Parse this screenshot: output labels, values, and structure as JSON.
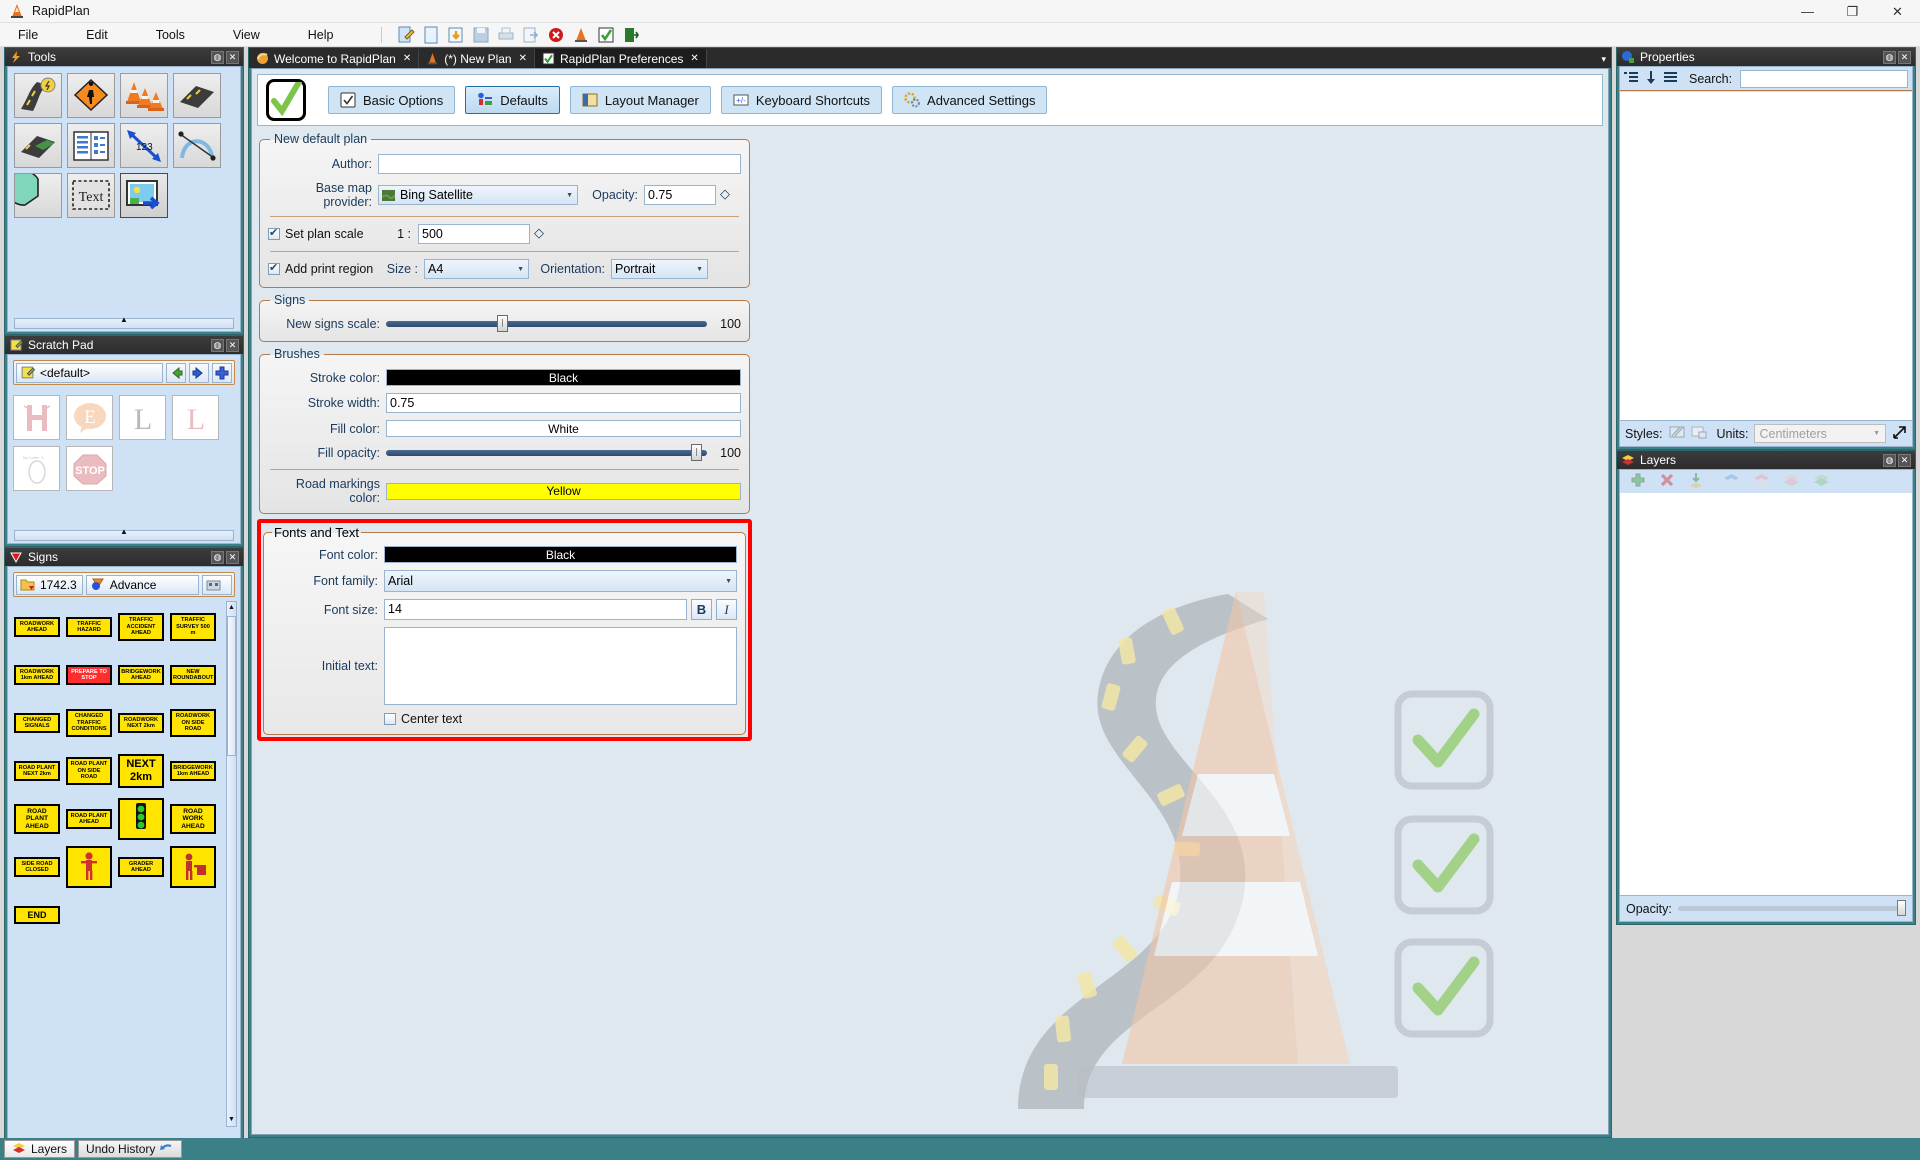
{
  "window": {
    "title": "RapidPlan",
    "app_icon": "rapidplan-cone-icon",
    "minimize": "—",
    "maximize": "❐",
    "close": "✕"
  },
  "menu": {
    "items": [
      {
        "label": "File",
        "name": "menu-file"
      },
      {
        "label": "Edit",
        "name": "menu-edit"
      },
      {
        "label": "Tools",
        "name": "menu-tools"
      },
      {
        "label": "View",
        "name": "menu-view"
      },
      {
        "label": "Help",
        "name": "menu-help"
      }
    ],
    "toolbar_icons": [
      "edit-plan-icon",
      "new-plan-icon",
      "open-plan-icon",
      "save-icon",
      "print-icon",
      "export-icon",
      "delete-icon",
      "cone-tool-icon",
      "preferences-check-icon",
      "exit-icon"
    ]
  },
  "tools_panel": {
    "title": "Tools",
    "icon": "lightning-icon",
    "pin": "◍",
    "close": "✕",
    "tools": [
      {
        "name": "road-tool",
        "label": "Road"
      },
      {
        "name": "sign-tool",
        "label": "Sign"
      },
      {
        "name": "cones-tool",
        "label": "Cones"
      },
      {
        "name": "road-segment-tool",
        "label": "Road segment"
      },
      {
        "name": "road-mesh-tool",
        "label": "Road mesh"
      },
      {
        "name": "legend-tool",
        "label": "Legend"
      },
      {
        "name": "dimension-tool",
        "label": "Dimension 123"
      },
      {
        "name": "curve-tool",
        "label": "Curve"
      },
      {
        "name": "arc-tool",
        "label": "Arc"
      },
      {
        "name": "text-tool",
        "label": "Text"
      },
      {
        "name": "image-tool",
        "label": "Image"
      }
    ]
  },
  "scratch_pad": {
    "title": "Scratch Pad",
    "icon": "notepad-icon",
    "pin": "◍",
    "close": "✕",
    "selected_set": "<default>",
    "set_icon": "notepad-icon",
    "prev_label": "◀",
    "next_label": "▶",
    "add_label": "✛",
    "items": [
      {
        "name": "scratch-item-h",
        "glyph": "H"
      },
      {
        "name": "scratch-item-e",
        "glyph": "E"
      },
      {
        "name": "scratch-item-l",
        "glyph": "L"
      },
      {
        "name": "scratch-item-l2",
        "glyph": "L"
      },
      {
        "name": "scratch-item-o",
        "glyph": "O"
      },
      {
        "name": "scratch-item-stop",
        "glyph": "STOP"
      }
    ]
  },
  "signs_panel": {
    "title": "Signs",
    "icon": "triangle-sign-icon",
    "pin": "◍",
    "close": "✕",
    "library_button": "1742.3",
    "library_icon": "folder-icon",
    "category_button": "Advance",
    "category_icon": "advance-icon",
    "more_icon": "grid-icon",
    "signs": [
      "ROADWORK AHEAD",
      "TRAFFIC HAZARD",
      "TRAFFIC ACCIDENT AHEAD",
      "TRAFFIC SURVEY 500 m",
      "ROADWORK 1km AHEAD",
      "PREPARE TO STOP",
      "BRIDGEWORK AHEAD",
      "NEW ROUNDABOUT",
      "CHANGED SIGNALS",
      "CHANGED TRAFFIC CONDITIONS",
      "ROADWORK NEXT 2km",
      "ROADWORK ON SIDE ROAD",
      "ROAD PLANT NEXT 2km",
      "ROAD PLANT ON SIDE ROAD",
      "NEXT 2km",
      "BRIDGEWORK 1km AHEAD",
      "ROAD PLANT AHEAD",
      "ROAD PLANT AHEAD",
      "TRAFFIC LIGHTS",
      "ROAD WORK AHEAD",
      "SIDE ROAD CLOSED",
      "WORKER SYMBOL",
      "GRADER AHEAD",
      "WORKER SYMBOL 2",
      "END"
    ]
  },
  "tabs": [
    {
      "label": "Welcome to RapidPlan",
      "icon": "welcome-icon",
      "active": false,
      "close": "✕"
    },
    {
      "label": "(*) New Plan",
      "icon": "cone-icon",
      "active": false,
      "close": "✕"
    },
    {
      "label": "RapidPlan Preferences",
      "icon": "check-icon",
      "active": true,
      "close": "✕"
    }
  ],
  "preferences": {
    "header_icon": "big-check-icon",
    "nav_tabs": [
      {
        "label": "Basic Options",
        "icon": "check-box-icon",
        "active": false
      },
      {
        "label": "Defaults",
        "icon": "defaults-icon",
        "active": true
      },
      {
        "label": "Layout Manager",
        "icon": "layout-icon",
        "active": false
      },
      {
        "label": "Keyboard Shortcuts",
        "icon": "keyboard-icon",
        "active": false
      },
      {
        "label": "Advanced Settings",
        "icon": "gears-icon",
        "active": false
      }
    ],
    "new_default_plan": {
      "legend": "New default plan",
      "author_label": "Author:",
      "author_value": "",
      "base_map_label": "Base map provider:",
      "base_map_value": "Bing Satellite",
      "base_map_icon": "satellite-thumb-icon",
      "opacity_label": "Opacity:",
      "opacity_value": "0.75",
      "set_plan_scale_label": "Set plan scale",
      "set_plan_scale_checked": true,
      "scale_prefix": "1 :",
      "scale_value": "500",
      "add_print_region_label": "Add print region",
      "add_print_region_checked": true,
      "size_label": "Size :",
      "size_value": "A4",
      "orientation_label": "Orientation:",
      "orientation_value": "Portrait"
    },
    "signs": {
      "legend": "Signs",
      "new_signs_scale_label": "New signs scale:",
      "new_signs_scale_value": "100",
      "slider_percent": 36
    },
    "brushes": {
      "legend": "Brushes",
      "stroke_color_label": "Stroke color:",
      "stroke_color_value": "Black",
      "stroke_color_hex": "#000000",
      "stroke_color_text_hex": "#ffffff",
      "stroke_width_label": "Stroke width:",
      "stroke_width_value": "0.75",
      "fill_color_label": "Fill color:",
      "fill_color_value": "White",
      "fill_color_hex": "#ffffff",
      "fill_color_text_hex": "#000000",
      "fill_opacity_label": "Fill opacity:",
      "fill_opacity_value": "100",
      "fill_opacity_percent": 97,
      "road_markings_label": "Road markings color:",
      "road_markings_value": "Yellow",
      "road_markings_hex": "#ffff00",
      "road_markings_text_hex": "#000000"
    },
    "fonts_and_text": {
      "legend": "Fonts and Text",
      "highlight_hex": "#ff0000",
      "font_color_label": "Font color:",
      "font_color_value": "Black",
      "font_color_hex": "#000000",
      "font_color_text_hex": "#ffffff",
      "font_family_label": "Font family:",
      "font_family_value": "Arial",
      "font_size_label": "Font size:",
      "font_size_value": "14",
      "bold_label": "B",
      "italic_label": "I",
      "initial_text_label": "Initial text:",
      "initial_text_value": "",
      "center_text_label": "Center text",
      "center_text_checked": false
    }
  },
  "properties_panel": {
    "title": "Properties",
    "icon": "properties-icon",
    "pin": "◍",
    "close": "✕",
    "toolbar_icons": [
      "categorized-icon",
      "sort-icon",
      "list-icon"
    ],
    "search_label": "Search:",
    "search_value": "",
    "styles_label": "Styles:",
    "styles_icons": [
      "style-brush-icon",
      "style-save-icon"
    ],
    "units_label": "Units:",
    "units_value": "Centimeters",
    "expand_icon": "expand-icon"
  },
  "layers_panel": {
    "title": "Layers",
    "icon": "layers-icon",
    "pin": "◍",
    "close": "✕",
    "toolbar_icons": [
      "add-layer-icon",
      "delete-layer-icon",
      "import-layer-icon",
      "layer-up-icon",
      "layer-down-icon",
      "layer-merge-icon",
      "layer-all-icon"
    ],
    "opacity_label": "Opacity:",
    "opacity_percent": 100
  },
  "statusbar": {
    "tabs": [
      {
        "label": "Layers",
        "icon": "layers-icon",
        "active": true
      },
      {
        "label": "Undo History",
        "icon": "undo-icon",
        "active": false
      }
    ]
  }
}
